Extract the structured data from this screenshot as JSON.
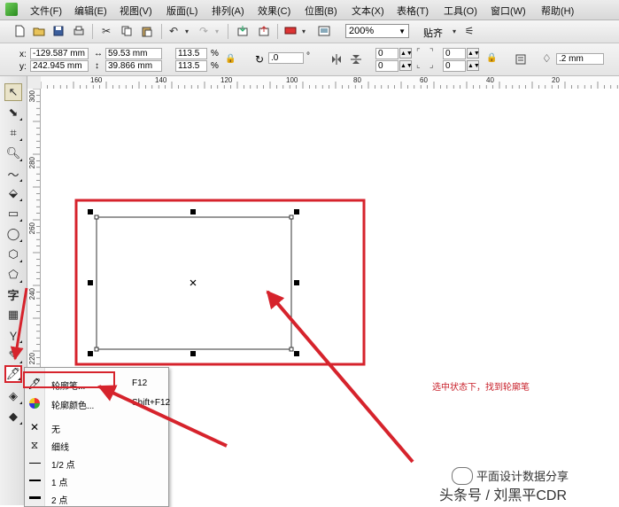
{
  "menu": [
    "文件(F)",
    "编辑(E)",
    "视图(V)",
    "版面(L)",
    "排列(A)",
    "效果(C)",
    "位图(B)",
    "文本(X)",
    "表格(T)",
    "工具(O)",
    "窗口(W)",
    "帮助(H)"
  ],
  "toolbar": {
    "zoom": "200%",
    "snap_label": "贴齐"
  },
  "properties": {
    "x_label": "x:",
    "x_value": "-129.587 mm",
    "y_label": "y:",
    "y_value": "242.945 mm",
    "width_value": "59.53 mm",
    "height_value": "39.866 mm",
    "scale_w": "113.5",
    "scale_h": "113.5",
    "percent": "%",
    "rotation": ".0",
    "degree": "°",
    "corner_1": "0",
    "corner_2": "0",
    "corner_3": "0",
    "corner_4": "0",
    "outline_width": ".2 mm"
  },
  "ruler": {
    "top_labels": [
      "160",
      "140",
      "120",
      "100",
      "80",
      "60",
      "40",
      "20"
    ],
    "left_labels": [
      "300",
      "280",
      "260",
      "240",
      "220"
    ]
  },
  "flyout": {
    "items": [
      {
        "icon": "pen-icon",
        "label": "轮廓笔...",
        "shortcut": "F12"
      },
      {
        "icon": "color-wheel-icon",
        "label": "轮廓颜色...",
        "shortcut": "Shift+F12"
      },
      {
        "icon": "x-icon",
        "label": "无",
        "shortcut": ""
      },
      {
        "icon": "hourglass-icon",
        "label": "细线",
        "shortcut": ""
      },
      {
        "icon": "line-half-icon",
        "label": "1/2 点",
        "shortcut": ""
      },
      {
        "icon": "line-1pt-icon",
        "label": "1 点",
        "shortcut": ""
      },
      {
        "icon": "line-2pt-icon",
        "label": "2 点",
        "shortcut": ""
      }
    ]
  },
  "annotation": "选中状态下，找到轮廓笔",
  "watermark": {
    "line1": "平面设计数据分享",
    "line2": "头条号 / 刘黑平CDR"
  },
  "colors": {
    "annotation_red": "#d6232c"
  }
}
